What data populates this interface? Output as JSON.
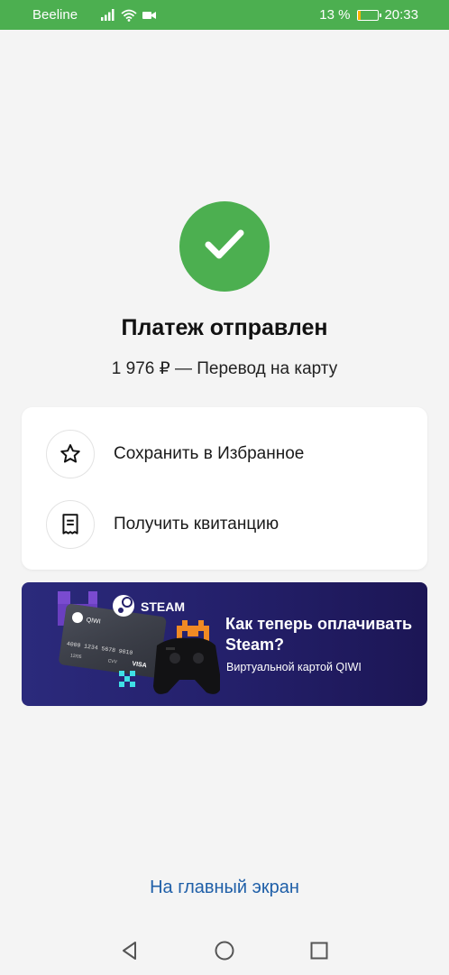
{
  "status_bar": {
    "carrier": "Beeline",
    "battery_percent": "13 %",
    "battery_level": 0.13,
    "time": "20:33",
    "icons": [
      "signal-icon",
      "wifi-icon",
      "video-icon",
      "battery-icon"
    ]
  },
  "success": {
    "icon": "checkmark-icon",
    "title": "Платеж отправлен",
    "subtitle": "1 976 ₽ — Перевод на карту"
  },
  "actions": [
    {
      "icon": "star-icon",
      "label": "Сохранить в Избранное"
    },
    {
      "icon": "receipt-icon",
      "label": "Получить квитанцию"
    }
  ],
  "banner": {
    "brand": "STEAM",
    "title": "Как теперь оплачивать Steam?",
    "subtitle": "Виртуальной картой QIWI",
    "card_brand": "QIWI",
    "card_number": "4000 1234 5678 9010",
    "card_expiry": "12/05",
    "card_cvv": "CVV",
    "card_network": "VISA"
  },
  "home_link": "На главный экран",
  "colors": {
    "accent_green": "#4caf50",
    "link_blue": "#1f5fa8",
    "banner_bg": "#24206b"
  }
}
